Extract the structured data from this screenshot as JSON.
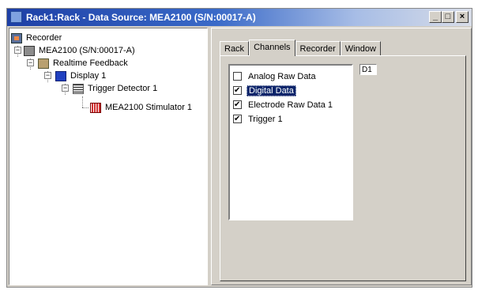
{
  "window": {
    "title": "Rack1:Rack - Data Source: MEA2100 (S/N:00017-A)",
    "controls": {
      "minimize": "_",
      "maximize": "□",
      "close": "×"
    }
  },
  "tree": {
    "root": "Recorder",
    "device": "MEA2100 (S/N:00017-A)",
    "feedback": "Realtime Feedback",
    "display": "Display 1",
    "trigger": "Trigger Detector 1",
    "stimulator": "MEA2100 Stimulator 1"
  },
  "tabs": [
    {
      "label": "Rack"
    },
    {
      "label": "Channels"
    },
    {
      "label": "Recorder"
    },
    {
      "label": "Window"
    }
  ],
  "active_tab": "Channels",
  "channels": [
    {
      "label": "Analog Raw Data",
      "checked": false
    },
    {
      "label": "Digital Data",
      "checked": true
    },
    {
      "label": "Electrode Raw Data 1",
      "checked": true
    },
    {
      "label": "Trigger 1",
      "checked": true
    }
  ],
  "selected_channel": "Digital Data",
  "channel_id": "D1"
}
